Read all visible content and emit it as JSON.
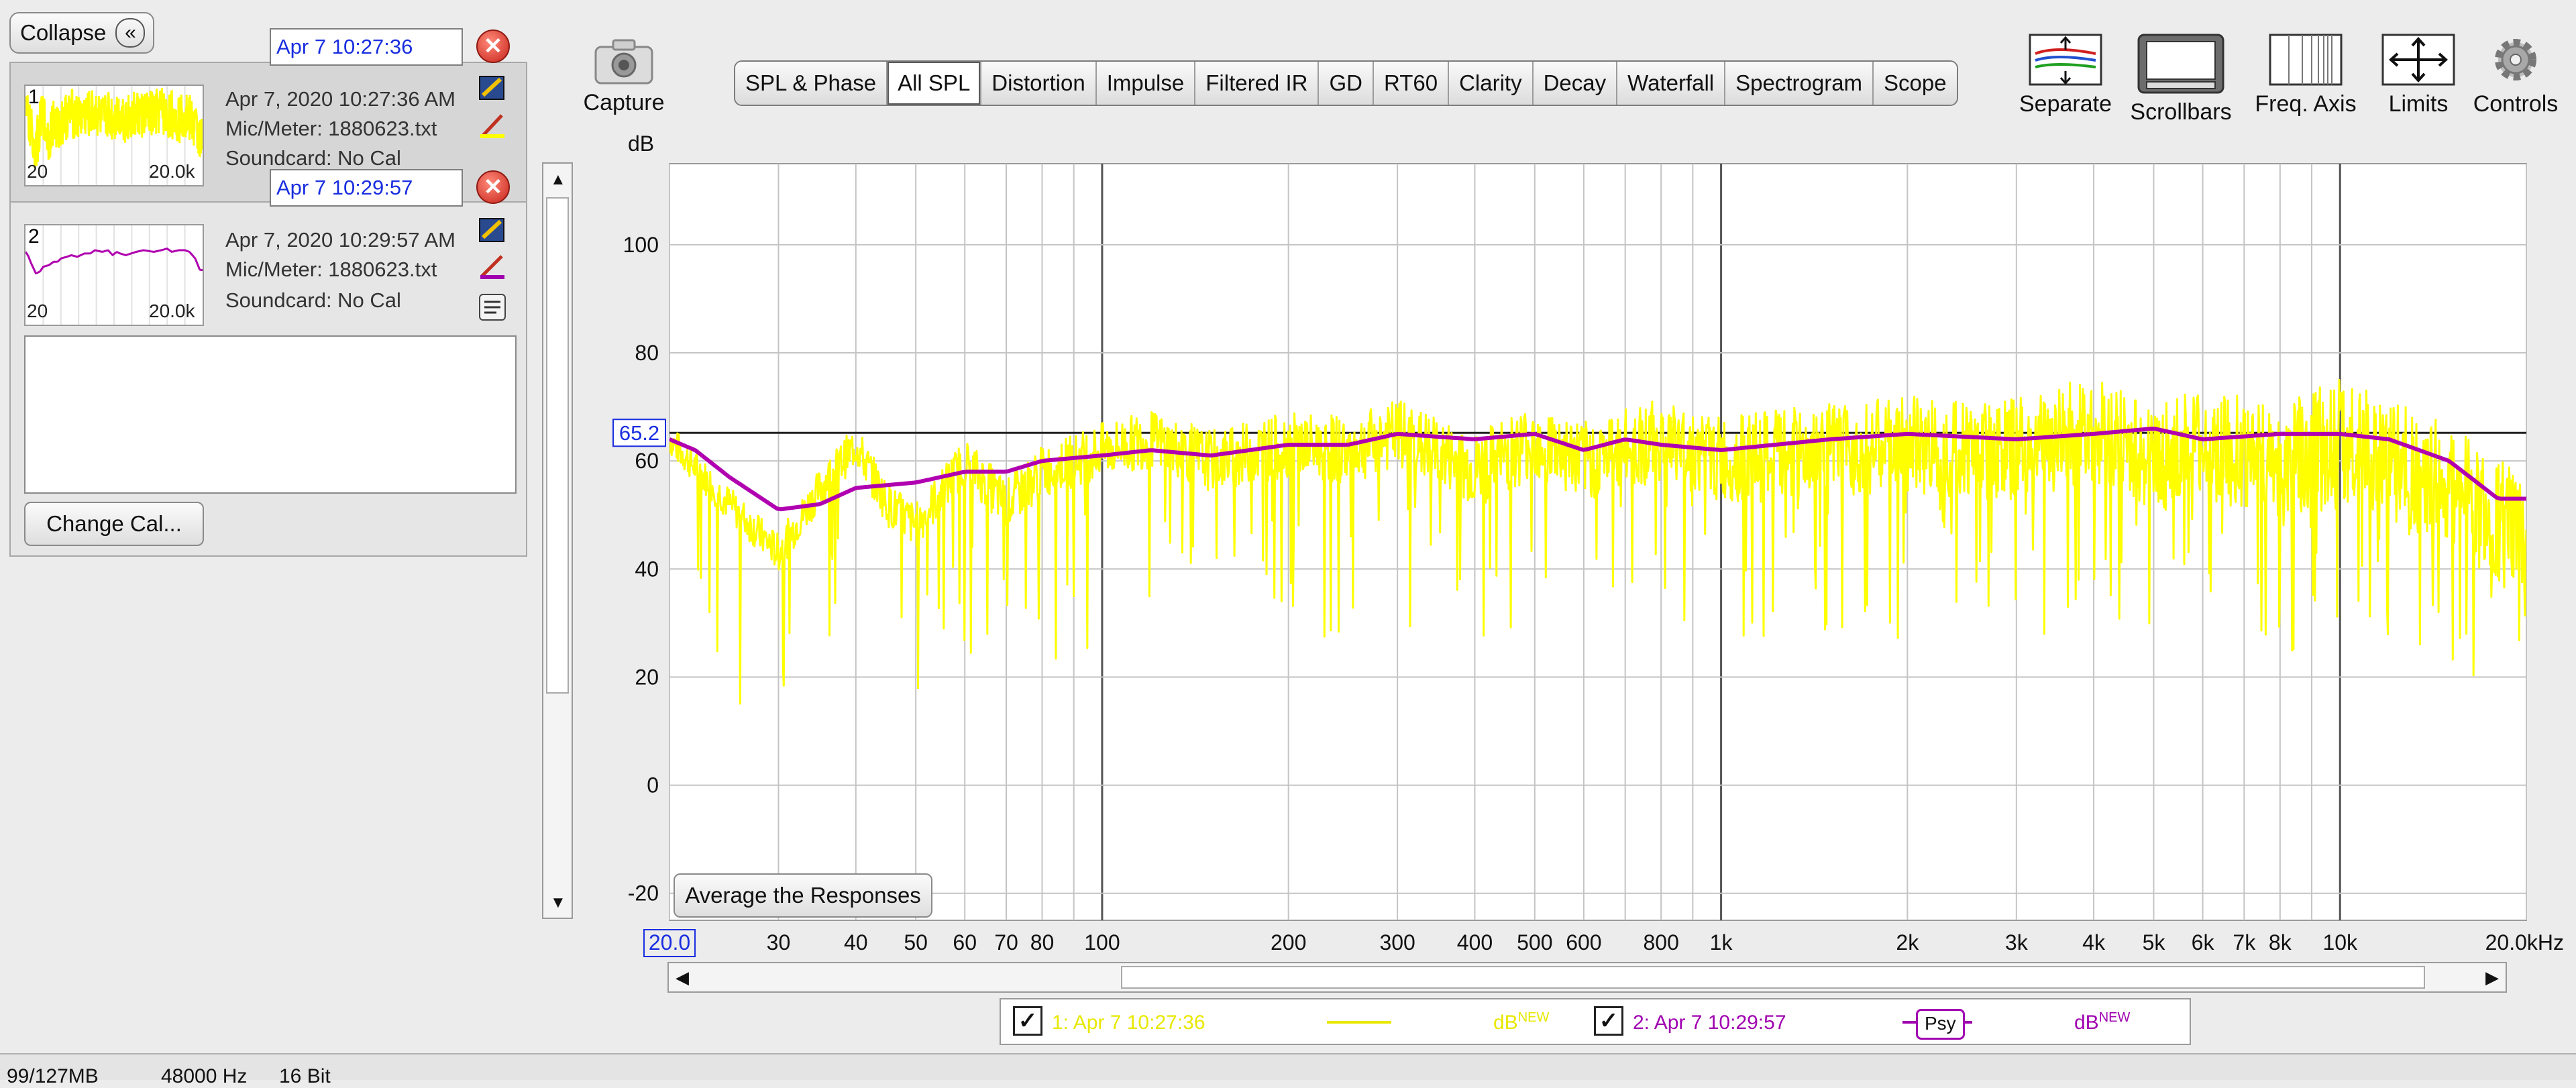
{
  "sidebar": {
    "collapse_label": "Collapse",
    "collapse_icon": "double-chevron-left-icon",
    "measurements": [
      {
        "number": "1",
        "name": "Apr 7 10:27:36",
        "datetime": "Apr 7, 2020 10:27:36 AM",
        "mic": "Mic/Meter: 1880623.txt",
        "soundcard": "Soundcard: No Cal",
        "thumb_min": "20",
        "thumb_max": "20.0k",
        "color": "#ffff00"
      },
      {
        "number": "2",
        "name": "Apr 7 10:29:57",
        "datetime": "Apr 7, 2020 10:29:57 AM",
        "mic": "Mic/Meter: 1880623.txt",
        "soundcard": "Soundcard: No Cal",
        "thumb_min": "20",
        "thumb_max": "20.0k",
        "color": "#b000b0"
      }
    ],
    "notes": "",
    "change_cal_label": "Change Cal..."
  },
  "toolbar": {
    "capture_label": "Capture",
    "tabs": [
      "SPL & Phase",
      "All SPL",
      "Distortion",
      "Impulse",
      "Filtered IR",
      "GD",
      "RT60",
      "Clarity",
      "Decay",
      "Waterfall",
      "Spectrogram",
      "Scope"
    ],
    "active_tab": "All SPL",
    "tools": [
      "Separate",
      "Scrollbars",
      "Freq. Axis",
      "Limits",
      "Controls"
    ]
  },
  "average_button_label": "Average the Responses",
  "legend": {
    "items": [
      {
        "label": "1: Apr 7 10:27:36",
        "unit": "dB",
        "sup": "NEW",
        "checked": "✓",
        "color": "#e8e800"
      },
      {
        "label": "2: Apr 7 10:29:57",
        "unit": "dB",
        "sup": "NEW",
        "checked": "✓",
        "color": "#a000b0",
        "badge": "Psy"
      }
    ]
  },
  "status": {
    "memory": "99/127MB",
    "rate": "48000 Hz",
    "bits": "16 Bit"
  },
  "chart_data": {
    "type": "line",
    "ylabel": "dB",
    "xunit": "Hz",
    "xscale": "log",
    "xlim": [
      20,
      20000
    ],
    "ylim": [
      -25,
      115
    ],
    "yticks": [
      "100",
      "80",
      "60",
      "40",
      "20",
      "0",
      "-20"
    ],
    "yticks_values": [
      100,
      80,
      60,
      40,
      20,
      0,
      -20
    ],
    "xticks": [
      "20.0",
      "30",
      "40",
      "50",
      "60",
      "70",
      "80",
      "100",
      "200",
      "300",
      "400",
      "500",
      "600",
      "800",
      "1k",
      "2k",
      "3k",
      "4k",
      "5k",
      "6k",
      "7k",
      "8k",
      "10k",
      "20.0kHz"
    ],
    "xticks_values": [
      20,
      30,
      40,
      50,
      60,
      70,
      80,
      100,
      200,
      300,
      400,
      500,
      600,
      800,
      1000,
      2000,
      3000,
      4000,
      5000,
      6000,
      7000,
      8000,
      10000,
      20000
    ],
    "cursor_level": "65.2",
    "cursor_value": 65.2,
    "grid": true,
    "series": [
      {
        "name": "1: Apr 7 10:27:36",
        "color": "#ffff00",
        "style": "noisy",
        "x": [
          20,
          25,
          30,
          35,
          40,
          45,
          50,
          60,
          70,
          80,
          100,
          120,
          150,
          200,
          250,
          300,
          400,
          500,
          600,
          800,
          1000,
          1500,
          2000,
          3000,
          4000,
          5000,
          6000,
          8000,
          10000,
          12000,
          15000,
          20000
        ],
        "y": [
          64,
          52,
          43,
          55,
          63,
          52,
          48,
          60,
          52,
          58,
          62,
          64,
          60,
          63,
          62,
          65,
          58,
          64,
          60,
          64,
          60,
          62,
          63,
          62,
          66,
          60,
          63,
          60,
          64,
          60,
          55,
          45
        ]
      },
      {
        "name": "2: Apr 7 10:29:57",
        "color": "#b000b0",
        "style": "smooth",
        "x": [
          20,
          22,
          25,
          30,
          35,
          40,
          50,
          60,
          70,
          80,
          100,
          120,
          150,
          200,
          250,
          300,
          400,
          500,
          600,
          700,
          800,
          1000,
          1500,
          2000,
          3000,
          4000,
          5000,
          6000,
          8000,
          10000,
          12000,
          15000,
          18000,
          20000
        ],
        "y": [
          64,
          62,
          57,
          51,
          52,
          55,
          56,
          58,
          58,
          60,
          61,
          62,
          61,
          63,
          63,
          65,
          64,
          65,
          62,
          64,
          63,
          62,
          64,
          65,
          64,
          65,
          66,
          64,
          65,
          65,
          64,
          60,
          53,
          53
        ]
      }
    ]
  }
}
